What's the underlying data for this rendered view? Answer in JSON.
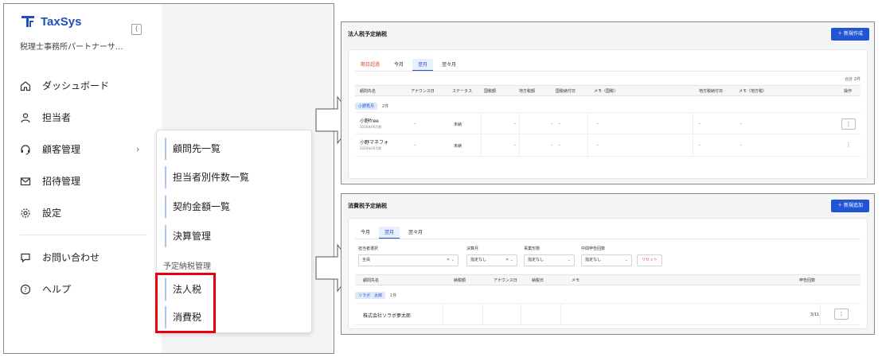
{
  "app": {
    "brand": "TaxSys",
    "office_name": "税理士事務所パートナーサ…",
    "nav": [
      {
        "label": "ダッシュボード",
        "icon": "home-icon"
      },
      {
        "label": "担当者",
        "icon": "user-icon"
      },
      {
        "label": "顧客管理",
        "icon": "headset-icon",
        "has_children": true
      },
      {
        "label": "招待管理",
        "icon": "mail-icon"
      },
      {
        "label": "設定",
        "icon": "gear-icon"
      }
    ],
    "nav_bottom": [
      {
        "label": "お問い合わせ",
        "icon": "chat-icon"
      },
      {
        "label": "ヘルプ",
        "icon": "help-icon"
      }
    ],
    "submenu": {
      "items": [
        "顧問先一覧",
        "担当者別件数一覧",
        "契約金額一覧",
        "決算管理"
      ],
      "group_label": "予定納税管理",
      "group_items": [
        "法人税",
        "消費税"
      ]
    },
    "highlight_color": "#e60012",
    "accent_color": "#2255d4"
  },
  "panel_corp": {
    "title": "法人税予定納税",
    "new_button": "＋ 新規作成",
    "tabs": [
      "期日超過",
      "今月",
      "翌月",
      "翌々月"
    ],
    "active_tab": "翌月",
    "total": "合計 2件",
    "columns": [
      "顧問先名",
      "アナウンス日",
      "ステータス",
      "国税額",
      "地方税額",
      "国税納付日",
      "メモ（国税）",
      "地方税納付日",
      "メモ（地方税）",
      "操作"
    ],
    "group": {
      "label": "小野秀月",
      "count": "2件"
    },
    "rows": [
      {
        "name": "小野free",
        "date": "2026年06月期",
        "announce": "-",
        "status": "未納",
        "national": "-",
        "local": "-",
        "nat_date": "-",
        "nat_memo": "-",
        "local_date": "-",
        "local_memo": "-",
        "action": "⋮"
      },
      {
        "name": "小野マネフォ",
        "date": "2026年06月期",
        "announce": "-",
        "status": "未納",
        "national": "-",
        "local": "-",
        "nat_date": "-",
        "nat_memo": "-",
        "local_date": "-",
        "local_memo": "-",
        "action": "⋮"
      }
    ]
  },
  "panel_cons": {
    "title": "消費税予定納税",
    "new_button": "＋ 新規追加",
    "tabs": [
      "今月",
      "翌月",
      "翌々月"
    ],
    "active_tab": "翌月",
    "filters": [
      {
        "label": "担当者選択",
        "value": "全員",
        "ctl": "✕ ⌄"
      },
      {
        "label": "決算月",
        "value": "指定なし",
        "ctl": "✕ ⌄"
      },
      {
        "label": "事業形態",
        "value": "指定なし",
        "ctl": "⌄"
      },
      {
        "label": "中間申告回数",
        "value": "指定なし",
        "ctl": "⌄"
      }
    ],
    "reset": "リセット",
    "columns": [
      "顧問先名",
      "納税額",
      "アナウンス日",
      "納税日",
      "メモ",
      "申告回数"
    ],
    "group": {
      "label": "ソラボ　太郎",
      "count": "1件"
    },
    "rows": [
      {
        "name": "株式会社ソラボ夢太郎",
        "count": "3/11",
        "action": "⋮"
      }
    ]
  }
}
